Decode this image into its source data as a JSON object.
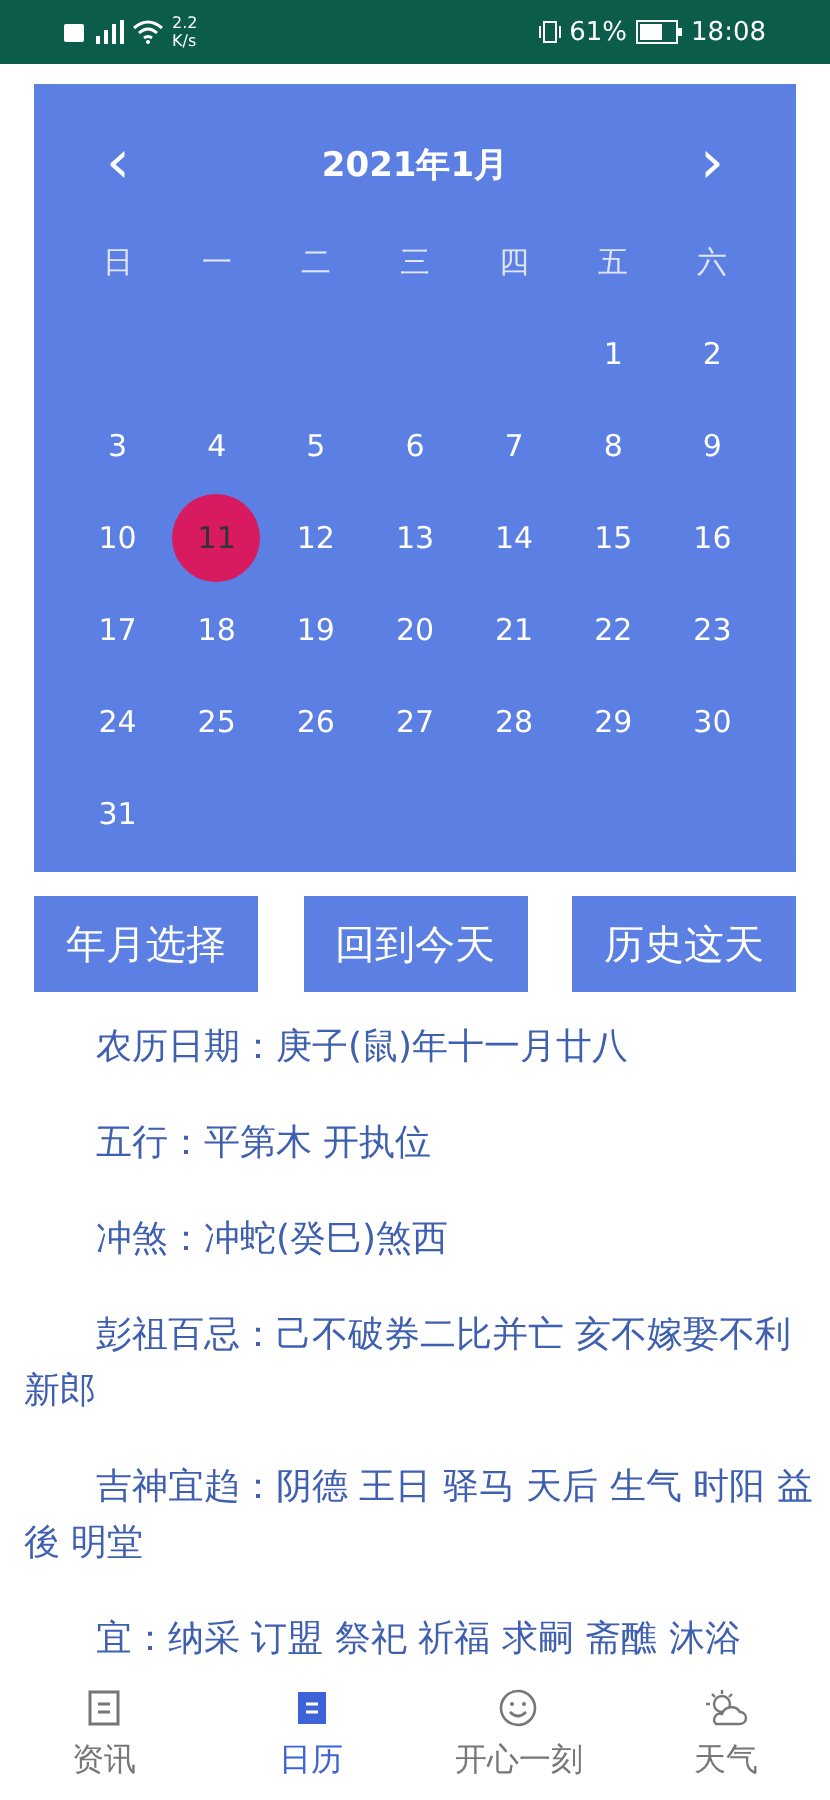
{
  "status_bar": {
    "speed": "2.2",
    "speed_unit": "K/s",
    "battery": "61%",
    "time": "18:08"
  },
  "calendar": {
    "prev": "‹",
    "title": "2021年1月",
    "next": "›",
    "weekdays": [
      "日",
      "一",
      "二",
      "三",
      "四",
      "五",
      "六"
    ],
    "weeks": [
      {
        "days": [
          {
            "label": "1",
            "selected": false
          },
          {
            "label": "2",
            "selected": false
          }
        ]
      },
      {
        "days": [
          {
            "label": "3",
            "selected": false
          },
          {
            "label": "4",
            "selected": false
          },
          {
            "label": "5",
            "selected": false
          },
          {
            "label": "6",
            "selected": false
          },
          {
            "label": "7",
            "selected": false
          },
          {
            "label": "8",
            "selected": false
          },
          {
            "label": "9",
            "selected": false
          }
        ]
      },
      {
        "days": [
          {
            "label": "10",
            "selected": false
          },
          {
            "label": "11",
            "selected": true
          },
          {
            "label": "12",
            "selected": false
          },
          {
            "label": "13",
            "selected": false
          },
          {
            "label": "14",
            "selected": false
          },
          {
            "label": "15",
            "selected": false
          },
          {
            "label": "16",
            "selected": false
          }
        ]
      },
      {
        "days": [
          {
            "label": "17",
            "selected": false
          },
          {
            "label": "18",
            "selected": false
          },
          {
            "label": "19",
            "selected": false
          },
          {
            "label": "20",
            "selected": false
          },
          {
            "label": "21",
            "selected": false
          },
          {
            "label": "22",
            "selected": false
          },
          {
            "label": "23",
            "selected": false
          }
        ]
      },
      {
        "days": [
          {
            "label": "24",
            "selected": false
          },
          {
            "label": "25",
            "selected": false
          },
          {
            "label": "26",
            "selected": false
          },
          {
            "label": "27",
            "selected": false
          },
          {
            "label": "28",
            "selected": false
          },
          {
            "label": "29",
            "selected": false
          },
          {
            "label": "30",
            "selected": false
          }
        ]
      },
      {
        "days": [
          {
            "label": "31",
            "selected": false
          }
        ]
      }
    ]
  },
  "buttons": [
    "年月选择",
    "回到今天",
    "历史这天"
  ],
  "info": [
    "农历日期：庚子(鼠)年十一月廿八",
    "五行：平第木 开执位",
    "冲煞：冲蛇(癸巳)煞西",
    "彭祖百忌：己不破券二比并亡 亥不嫁娶不利新郎",
    "吉神宜趋：阴德 王日 驿马 天后 生气 时阳 益後 明堂",
    "宜：纳采 订盟 祭祀 祈福 求嗣 斋醮 沐浴"
  ],
  "nav": [
    {
      "label": "资讯",
      "selected": false
    },
    {
      "label": "日历",
      "selected": true
    },
    {
      "label": "开心一刻",
      "selected": false
    },
    {
      "label": "天气",
      "selected": false
    }
  ]
}
